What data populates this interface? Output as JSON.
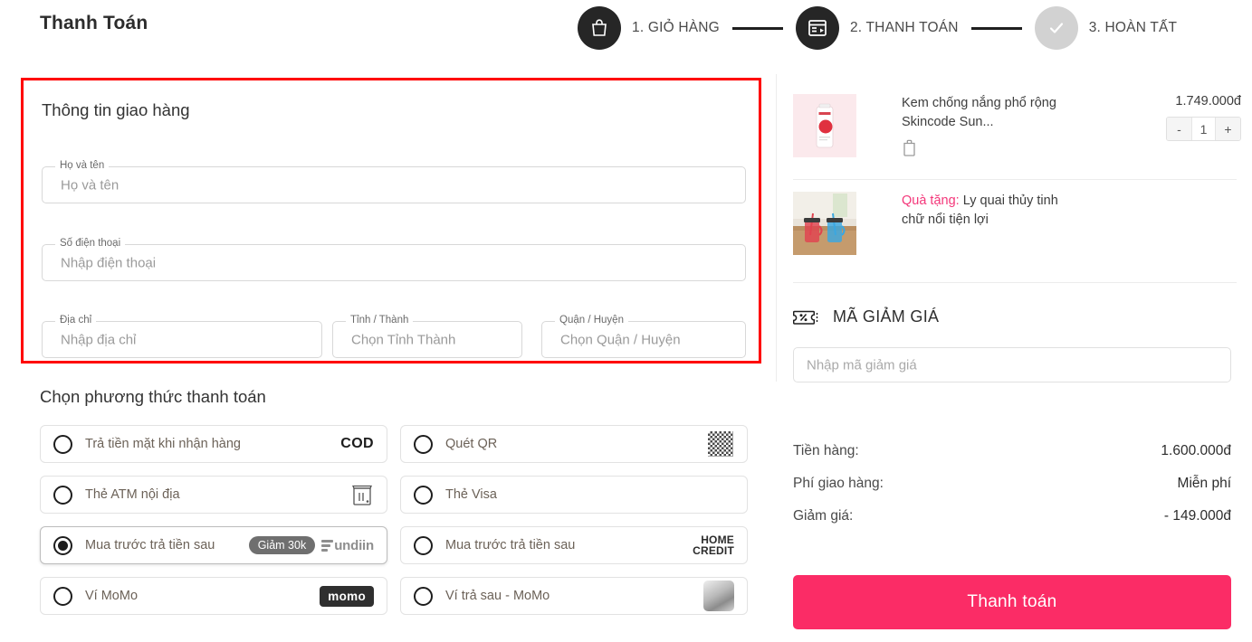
{
  "header": {
    "title": "Thanh Toán",
    "steps": [
      {
        "label": "1. GIỎ HÀNG",
        "icon": "shopping-bag-icon",
        "state": "active"
      },
      {
        "label": "2. THANH TOÁN",
        "icon": "payment-card-icon",
        "state": "active"
      },
      {
        "label": "3. HOÀN TẤT",
        "icon": "check-icon",
        "state": "inactive"
      }
    ]
  },
  "shipping": {
    "heading": "Thông tin giao hàng",
    "highlight_color": "#ff0000",
    "fields": [
      {
        "legend": "Họ và tên",
        "placeholder": "Họ và tên",
        "value": ""
      },
      {
        "legend": "Số điện thoại",
        "placeholder": "Nhập điện thoại",
        "value": ""
      },
      {
        "legend": "Địa chỉ",
        "placeholder": "Nhập địa chỉ",
        "value": ""
      },
      {
        "legend": "Tỉnh / Thành",
        "placeholder": "Chọn Tỉnh Thành",
        "value": ""
      },
      {
        "legend": "Quận / Huyện",
        "placeholder": "Chọn Quận / Huyện",
        "value": ""
      }
    ]
  },
  "payment": {
    "heading": "Chọn phương thức thanh toán",
    "options": [
      {
        "label": "Trả tiền mặt khi nhận hàng",
        "selected": false,
        "logo": "cod-text",
        "logo_text": "COD"
      },
      {
        "label": "Quét QR",
        "selected": false,
        "logo": "qr-code-icon",
        "logo_text": ""
      },
      {
        "label": "Thẻ ATM nội địa",
        "selected": false,
        "logo": "atm-machine-icon",
        "logo_text": ""
      },
      {
        "label": "Thẻ Visa",
        "selected": false,
        "logo": "none",
        "logo_text": ""
      },
      {
        "label": "Mua trước trả tiền sau",
        "selected": true,
        "logo": "fundiin-logo",
        "logo_text": "undiin",
        "badge": "Giảm 30k"
      },
      {
        "label": "Mua trước trả tiền sau",
        "selected": false,
        "logo": "home-credit-logo",
        "logo_text_1": "HOME",
        "logo_text_2": "CREDIT"
      },
      {
        "label": "Ví MoMo",
        "selected": false,
        "logo": "momo-logo",
        "logo_text": "momo"
      },
      {
        "label": "Ví trả sau - MoMo",
        "selected": false,
        "logo": "momo-later-image",
        "logo_text": ""
      }
    ]
  },
  "cart": {
    "items": [
      {
        "name": "Kem chống nắng phổ rộng Skincode Sun...",
        "price": "1.749.000đ",
        "quantity": "1",
        "minus_label": "-",
        "plus_label": "+",
        "delete_icon": "trash-icon",
        "thumbnail": "sunscreen-tube-image"
      }
    ],
    "gift": {
      "tag": "Quà tặng:",
      "name": " Ly quai thủy tinh chữ nổi tiện lợi",
      "thumbnail": "glass-jars-image",
      "tag_color": "#f4377a"
    }
  },
  "coupon": {
    "title": "MÃ GIẢM GIÁ",
    "icon": "coupon-ticket-icon",
    "placeholder": "Nhập mã giảm giá",
    "value": ""
  },
  "totals": {
    "rows": [
      {
        "label": "Tiền hàng:",
        "value": "1.600.000đ"
      },
      {
        "label": "Phí giao hàng:",
        "value": "Miễn phí"
      },
      {
        "label": "Giảm giá:",
        "value": "- 149.000đ"
      }
    ]
  },
  "checkout": {
    "label": "Thanh toán",
    "color": "#fb2c66"
  }
}
